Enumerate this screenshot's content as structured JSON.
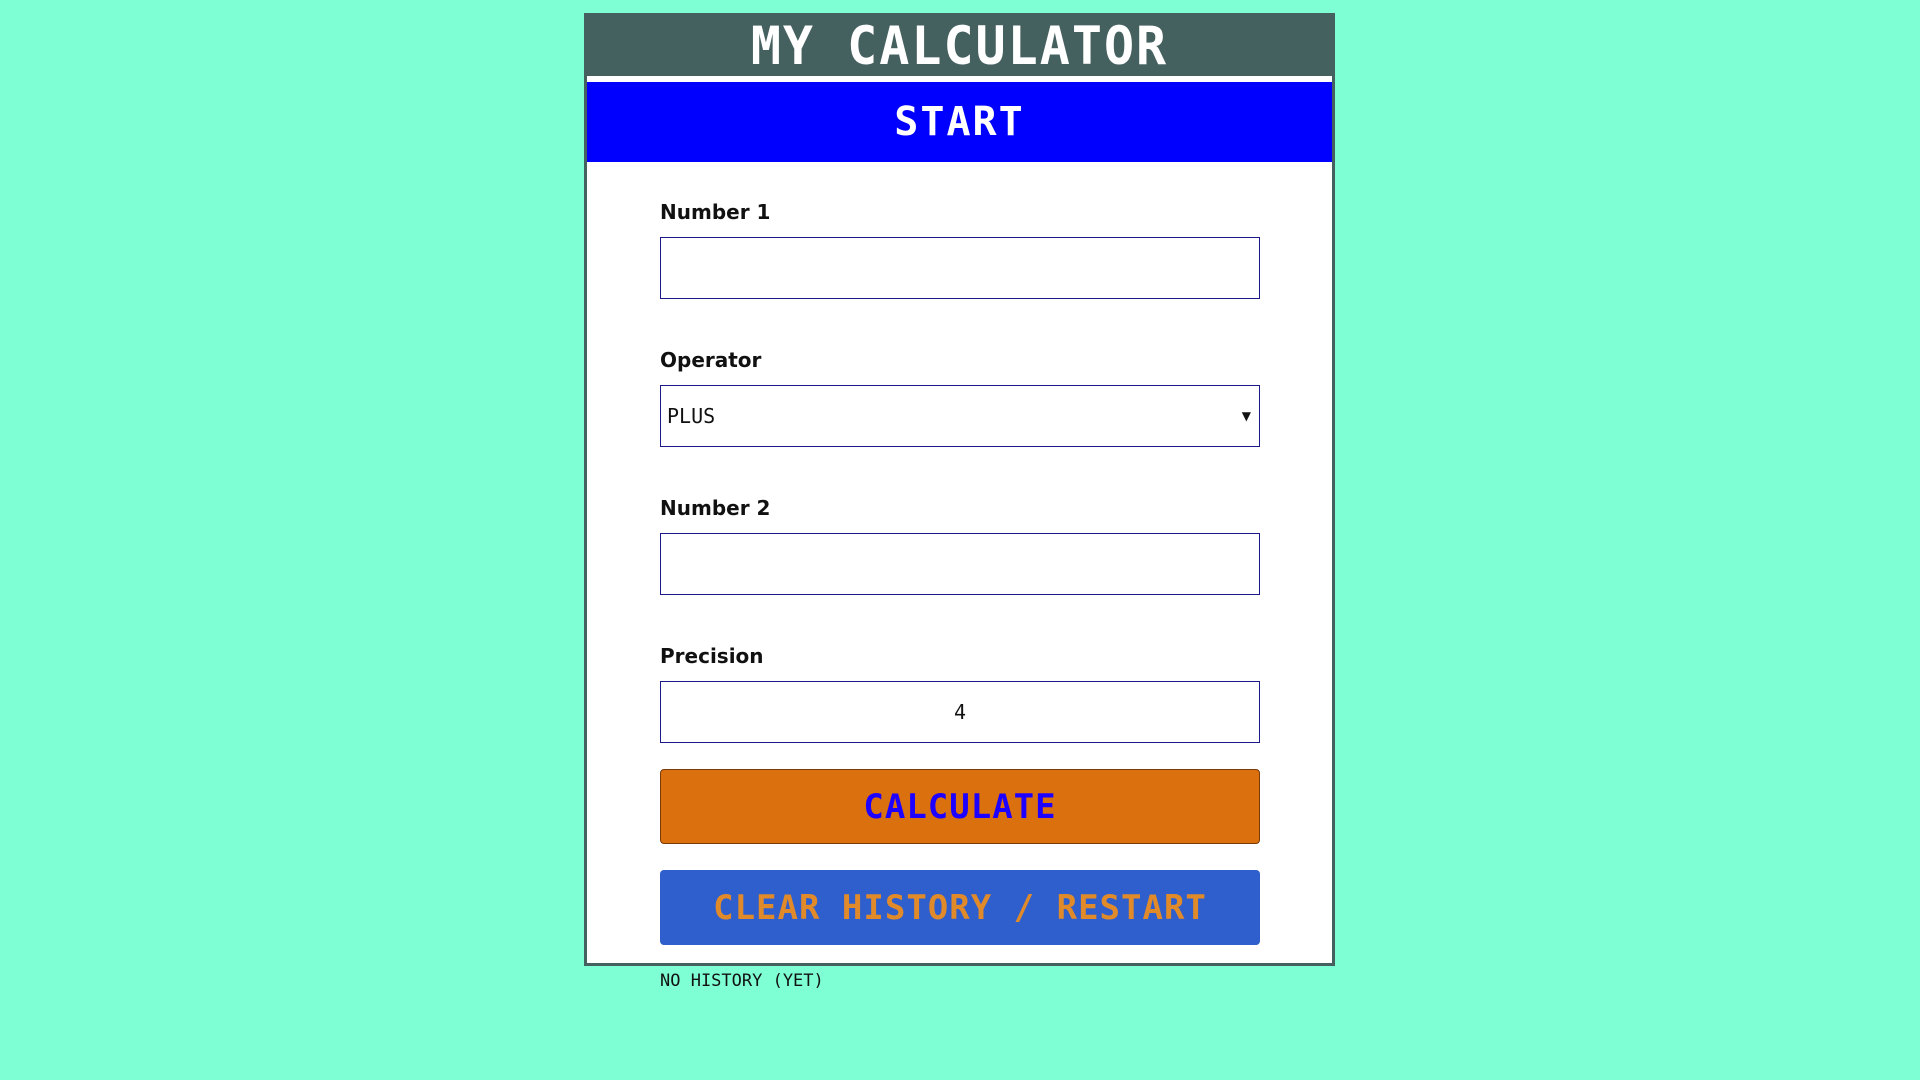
{
  "app": {
    "title": "My Calculator",
    "stage": "Start"
  },
  "form": {
    "number1": {
      "label": "Number 1",
      "value": "",
      "placeholder": ""
    },
    "operator": {
      "label": "Operator",
      "selected": "Plus"
    },
    "number2": {
      "label": "Number 2",
      "value": "",
      "placeholder": ""
    },
    "precision": {
      "label": "Precision",
      "value": "4"
    }
  },
  "buttons": {
    "calculate": "Calculate",
    "clear": "Clear History / Restart"
  },
  "history": {
    "empty_text": "No History (yet)"
  },
  "colors": {
    "background": "#7fffd4",
    "title_bar": "#45615f",
    "start_bar": "#0000ff",
    "calculate_bg": "#db700e",
    "calculate_text": "#1e00ff",
    "clear_bg": "#2f5fcc",
    "clear_text": "#e08a2a"
  }
}
